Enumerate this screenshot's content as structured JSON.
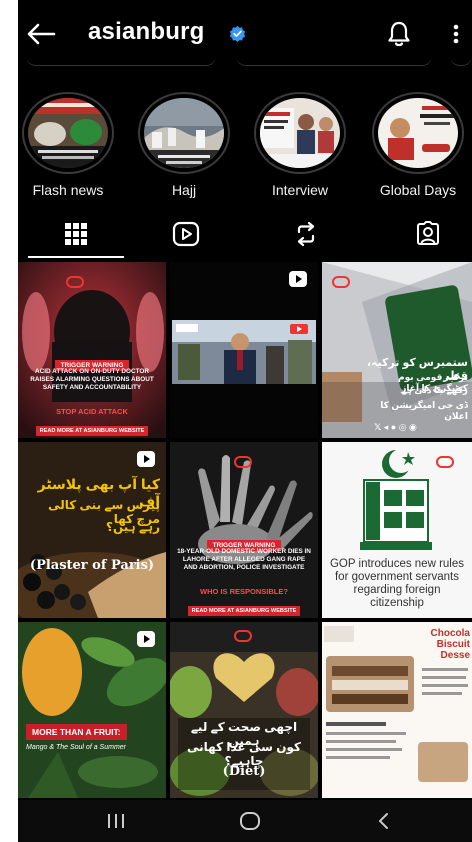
{
  "header": {
    "username": "asianburg",
    "verified": true,
    "back_icon": "back-arrow-icon",
    "bell_icon": "bell-icon",
    "more_icon": "more-vertical-icon"
  },
  "highlights": [
    {
      "label": "Flash news"
    },
    {
      "label": "Hajj"
    },
    {
      "label": "Interview"
    },
    {
      "label": "Global Days"
    }
  ],
  "tabs": [
    {
      "name": "grid",
      "icon": "grid-icon",
      "active": true
    },
    {
      "name": "reels",
      "icon": "reels-icon",
      "active": false
    },
    {
      "name": "reposts",
      "icon": "repost-icon",
      "active": false
    },
    {
      "name": "tagged",
      "icon": "tagged-person-icon",
      "active": false
    }
  ],
  "posts": {
    "p1": {
      "badge": "TRIGGER WARNING",
      "headline": "ACID ATTACK ON ON-DUTY DOCTOR RAISES ALARMING QUESTIONS ABOUT SAFETY AND ACCOUNTABILITY",
      "tagline": "STOP ACID ATTACK",
      "footer": "READ MORE AT ASIANBURG WEBSITE"
    },
    "p2": {
      "type": "reel"
    },
    "p3": {
      "urdu_line1": "ستمبرس کو ترکیہ، قطر",
      "urdu_line2": "ترکیہ قومی بوم کیٹیگری کا آغاز",
      "urdu_line3": "رکھے جا دلی ہے",
      "urdu_line4": "ڈی جی امیگریشن کا اعلان"
    },
    "p4": {
      "urdu_line1": "کیا آپ بھی پلاسٹر آف",
      "urdu_line2": "پیرس سے بنی کالی مرچ کھا",
      "urdu_line3": "رہے ہیں؟",
      "caption": "(Plaster of Paris)"
    },
    "p5": {
      "badge": "TRIGGER WARNING",
      "headline": "18-YEAR-OLD DOMESTIC WORKER DIES IN LAHORE AFTER ALLEGED GANG RAPE AND ABORTION, POLICE INVESTIGATE",
      "tagline": "WHO IS RESPONSIBLE?",
      "footer": "READ MORE AT ASIANBURG WEBSITE"
    },
    "p6": {
      "headline": "GOP introduces new rules for government servants regarding foreign citizenship"
    },
    "p7": {
      "headline": "MORE THAN A FRUIT:",
      "sub": "Mango & The Soul of a Summer"
    },
    "p8": {
      "urdu_line1": "اچھی صحت کے لیے ہمیں",
      "urdu_line2": "کون سی غذا کھانی چاہیے؟",
      "caption": "(Diet)"
    },
    "p9": {
      "title_line1": "Chocola",
      "title_line2": "Biscuit",
      "title_line3": "Desse"
    }
  },
  "navbar": {
    "recents_icon": "recents-icon",
    "home_icon": "home-circle-icon",
    "back_icon": "nav-back-icon"
  },
  "colors": {
    "background": "#000000",
    "verified_blue": "#3897f0",
    "brand_red": "#d9232d"
  }
}
